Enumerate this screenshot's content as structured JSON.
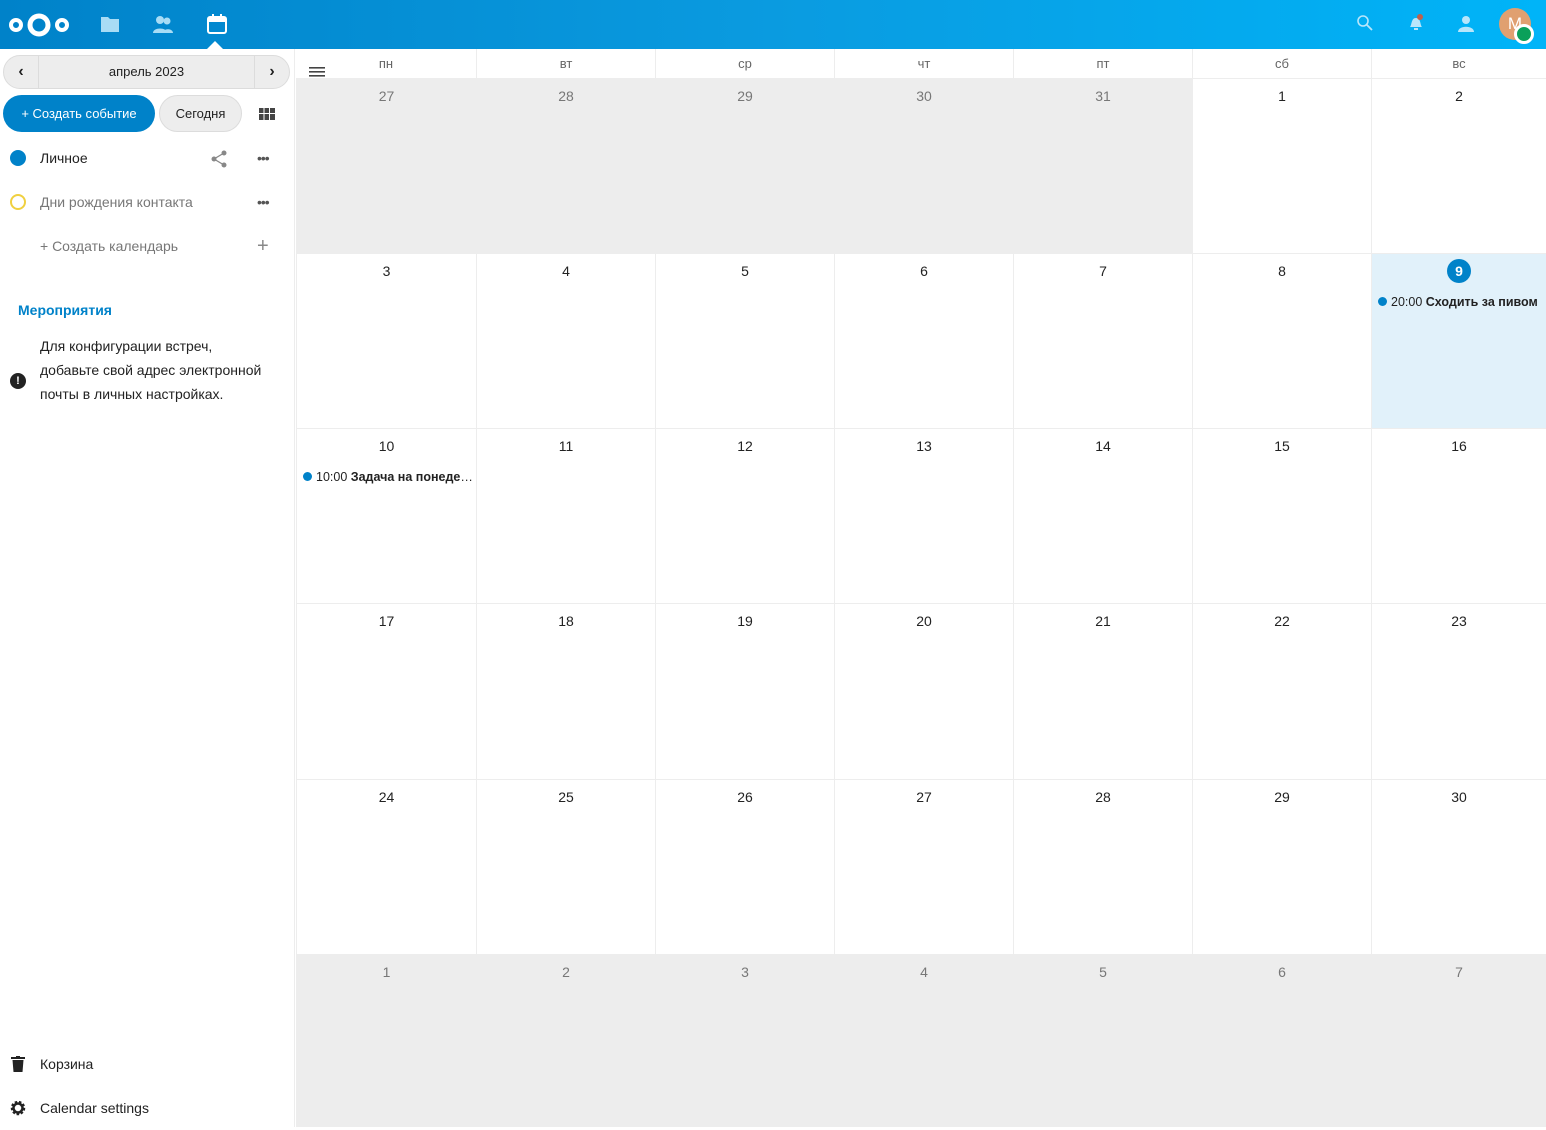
{
  "topbar": {
    "apps": [
      "files-icon",
      "contacts-icon",
      "calendar-icon"
    ],
    "avatar_initial": "M"
  },
  "sidebar": {
    "month_label": "апрель 2023",
    "new_event": "+ Создать событие",
    "today": "Сегодня",
    "calendars": [
      {
        "name": "Личное",
        "color": "#0082c9"
      },
      {
        "name": "Дни рождения контакта",
        "color": "#f0d040"
      }
    ],
    "new_calendar": "+ Создать календарь",
    "section_title": "Мероприятия",
    "warning": "Для конфигурации встреч, добавьте свой адрес электронной почты в личных настройках.",
    "trash": "Корзина",
    "settings": "Calendar settings"
  },
  "calendar": {
    "weekdays": [
      "пн",
      "вт",
      "ср",
      "чт",
      "пт",
      "сб",
      "вс"
    ],
    "weeks": [
      [
        {
          "d": "27",
          "o": 1
        },
        {
          "d": "28",
          "o": 1
        },
        {
          "d": "29",
          "o": 1
        },
        {
          "d": "30",
          "o": 1
        },
        {
          "d": "31",
          "o": 1
        },
        {
          "d": "1"
        },
        {
          "d": "2"
        }
      ],
      [
        {
          "d": "3"
        },
        {
          "d": "4"
        },
        {
          "d": "5"
        },
        {
          "d": "6"
        },
        {
          "d": "7"
        },
        {
          "d": "8"
        },
        {
          "d": "9",
          "today": 1,
          "events": [
            {
              "time": "20:00",
              "title": "Сходить за пивом"
            }
          ]
        }
      ],
      [
        {
          "d": "10",
          "events": [
            {
              "time": "10:00",
              "title": "Задача на понедельник"
            }
          ]
        },
        {
          "d": "11"
        },
        {
          "d": "12"
        },
        {
          "d": "13"
        },
        {
          "d": "14"
        },
        {
          "d": "15"
        },
        {
          "d": "16"
        }
      ],
      [
        {
          "d": "17"
        },
        {
          "d": "18"
        },
        {
          "d": "19"
        },
        {
          "d": "20"
        },
        {
          "d": "21"
        },
        {
          "d": "22"
        },
        {
          "d": "23"
        }
      ],
      [
        {
          "d": "24"
        },
        {
          "d": "25"
        },
        {
          "d": "26"
        },
        {
          "d": "27"
        },
        {
          "d": "28"
        },
        {
          "d": "29"
        },
        {
          "d": "30"
        }
      ],
      [
        {
          "d": "1",
          "o": 1
        },
        {
          "d": "2",
          "o": 1
        },
        {
          "d": "3",
          "o": 1
        },
        {
          "d": "4",
          "o": 1
        },
        {
          "d": "5",
          "o": 1
        },
        {
          "d": "6",
          "o": 1
        },
        {
          "d": "7",
          "o": 1
        }
      ]
    ]
  }
}
